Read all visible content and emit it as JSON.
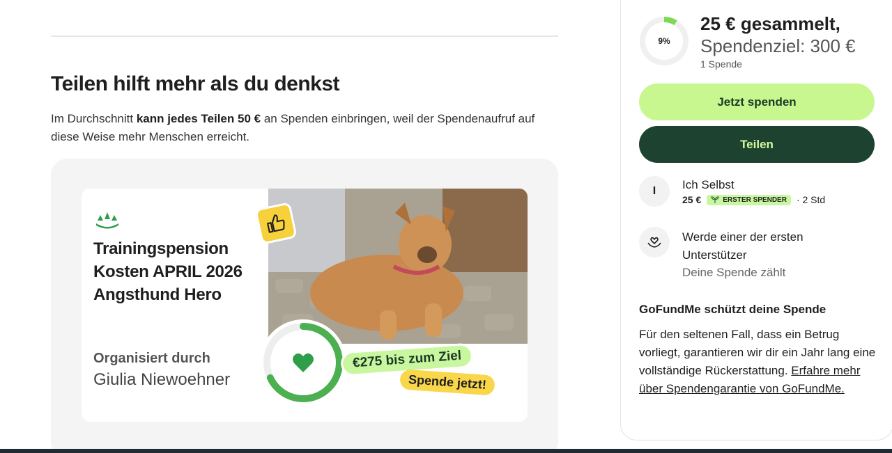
{
  "share": {
    "title": "Teilen hilft mehr als du denkst",
    "text_prefix": "Im Durchschnitt ",
    "text_bold": "kann jedes Teilen 50 €",
    "text_suffix": " an Spenden einbringen, weil der Spendenaufruf auf diese Weise mehr Menschen erreicht."
  },
  "card": {
    "title": "Trainingspension Kosten APRIL 2026 Angsthund Hero",
    "org_label": "Organisiert durch",
    "org_name": "Giulia Niewoehner",
    "to_goal": "€275 bis zum Ziel",
    "cta": "Spende jetzt!",
    "ring_progress": 0.68
  },
  "sidebar": {
    "percent": "9%",
    "progress": 0.09,
    "raised": "25 € gesammelt,",
    "goal": "Spendenziel: 300 €",
    "donation_count": "1 Spende",
    "donate_button": "Jetzt spenden",
    "share_button": "Teilen",
    "donor": {
      "initial": "I",
      "name": "Ich Selbst",
      "amount": "25 €",
      "badge": "ERSTER SPENDER",
      "time": "· 2 Std"
    },
    "become_first": "Werde einer der ersten Unterstützer",
    "donation_counts": "Deine Spende zählt",
    "protect_title": "GoFundMe schützt deine Spende",
    "protect_text": "Für den seltenen Fall, dass ein Betrug vorliegt, garantieren wir dir ein Jahr lang eine vollständige Rückerstattung. ",
    "protect_link": "Erfahre mehr über Spendengarantie von GoFundMe."
  },
  "colors": {
    "brand_green": "#c9f78f",
    "dark_green": "#1e4230",
    "badge_yellow": "#f9d64a"
  },
  "icons": [
    "gofundme-logo-icon",
    "thumbs-up-icon",
    "heart-icon",
    "sprout-icon",
    "hands-heart-icon"
  ]
}
